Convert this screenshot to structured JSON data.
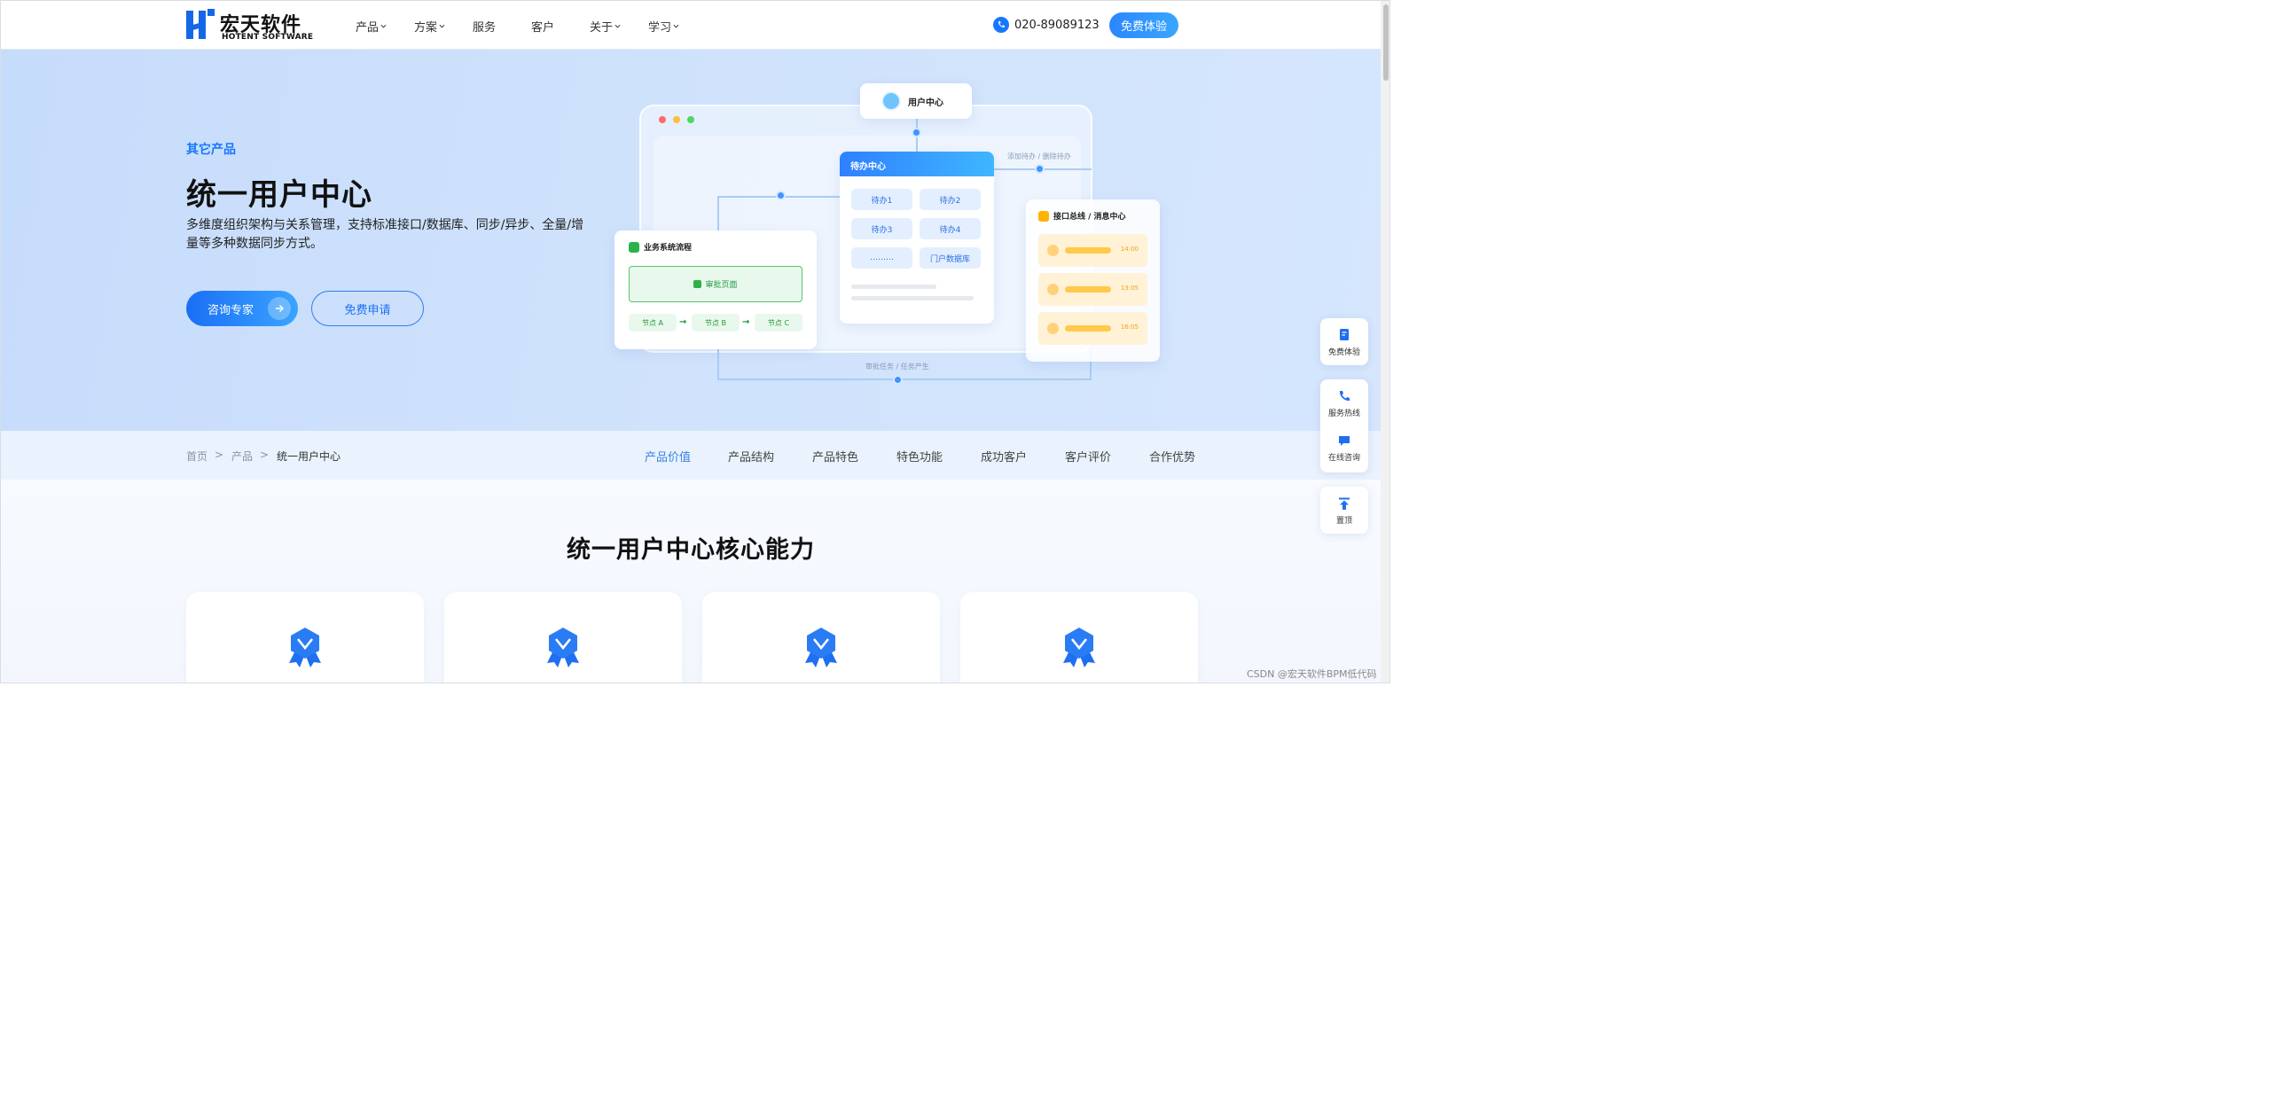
{
  "header": {
    "logo_cn": "宏天软件",
    "logo_en": "HOTENT SOFTWARE",
    "nav": [
      {
        "label": "产品",
        "has_menu": true
      },
      {
        "label": "方案",
        "has_menu": true
      },
      {
        "label": "服务",
        "has_menu": false
      },
      {
        "label": "客户",
        "has_menu": false
      },
      {
        "label": "关于",
        "has_menu": true
      },
      {
        "label": "学习",
        "has_menu": true
      }
    ],
    "phone": "020-89089123",
    "trial_button": "免费体验"
  },
  "hero": {
    "eyebrow": "其它产品",
    "title": "统一用户中心",
    "description": "多维度组织架构与关系管理，支持标准接口/数据库、同步/异步、全量/增量等多种数据同步方式。",
    "consult_button": "咨询专家",
    "apply_button": "免费申请",
    "illustration": {
      "user_center": "用户中心",
      "todo_center": "待办中心",
      "todo_items": [
        "待办1",
        "待办2",
        "待办3",
        "待办4",
        "………",
        "门户数据库"
      ],
      "biz_flow_title": "业务系统流程",
      "approve_page": "审批页面",
      "nodes": [
        "节点 A",
        "节点 B",
        "节点 C"
      ],
      "msg_title": "接口总线 / 消息中心",
      "msg_times": [
        "14:00",
        "13:05",
        "16:05"
      ],
      "label_add_remove": "添加待办 / 删除待办",
      "label_task": "审批任务 / 任务产生"
    }
  },
  "breadcrumb": {
    "items": [
      "首页",
      "产品",
      "统一用户中心"
    ],
    "separator": ">"
  },
  "tabs": [
    "产品价值",
    "产品结构",
    "产品特色",
    "特色功能",
    "成功客户",
    "客户评价",
    "合作优势"
  ],
  "active_tab": "产品价值",
  "section": {
    "title": "统一用户中心核心能力"
  },
  "float_toolbar": {
    "trial": "免费体验",
    "hotline": "服务热线",
    "online": "在线咨询",
    "top": "置顶"
  },
  "watermark": "CSDN @宏天软件BPM低代码",
  "colors": {
    "brand_blue": "#1677ff",
    "hero_bg": "#cfe2fc",
    "subnav_bg": "#e9f2fd",
    "active_tab": "#3a82e8"
  }
}
